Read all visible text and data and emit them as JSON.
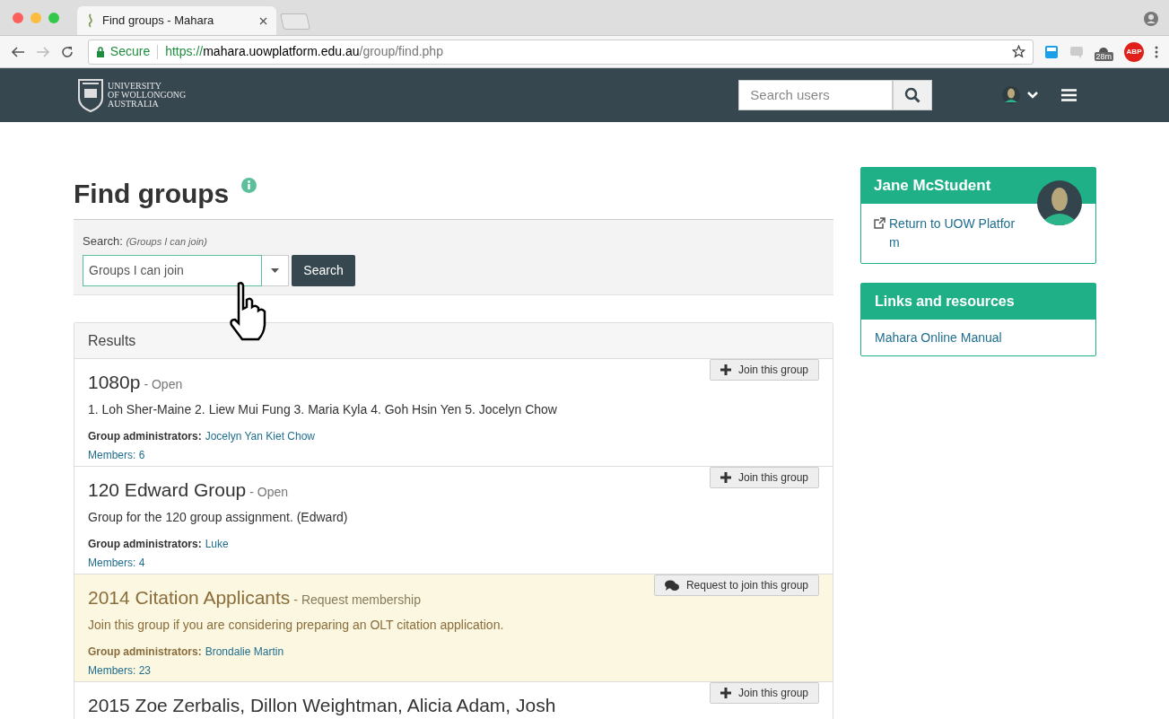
{
  "browser": {
    "tab_title": "Find groups - Mahara",
    "secure_label": "Secure",
    "url_scheme": "https://",
    "url_host": "mahara.uowplatform.edu.au",
    "url_path": "/group/find.php",
    "extension_badge": "28m",
    "abp_label": "ABP"
  },
  "header": {
    "logo_lines": [
      "UNIVERSITY",
      "OF WOLLONGONG",
      "AUSTRALIA"
    ],
    "search": {
      "placeholder": "Search users"
    }
  },
  "page": {
    "title": "Find groups",
    "search_label": "Search:",
    "search_hint": "(Groups I can join)",
    "filter_value": "Groups I can join",
    "search_button": "Search"
  },
  "results": {
    "heading": "Results",
    "groups": [
      {
        "name": "1080p",
        "membership": "- Open",
        "description": "1. Loh Sher-Maine 2. Liew Mui Fung 3. Maria Kyla 4. Goh Hsin Yen 5. Jocelyn Chow",
        "admins_label": "Group administrators:",
        "admins": "Jocelyn Yan Kiet Chow",
        "members": "Members: 6",
        "kind": "join",
        "button": "Join this group"
      },
      {
        "name": "120 Edward Group",
        "membership": "- Open",
        "description": "Group for the 120 group assignment. (Edward)",
        "admins_label": "Group administrators:",
        "admins": "Luke",
        "members": "Members: 4",
        "kind": "join",
        "button": "Join this group"
      },
      {
        "name": "2014 Citation Applicants",
        "membership": "- Request membership",
        "description": "Join this group if you are considering preparing an OLT citation application.",
        "admins_label": "Group administrators:",
        "admins": "Brondalie Martin",
        "members": "Members: 23",
        "kind": "request",
        "button": "Request to join this group"
      },
      {
        "name": "2015 Zoe Zerbalis, Dillon Weightman, Alicia Adam, Josh",
        "kind": "join",
        "button": "Join this group"
      }
    ]
  },
  "sidebar": {
    "profile": {
      "name": "Jane McStudent",
      "link": "Return to UOW Platfor m"
    },
    "links": {
      "title": "Links and resources",
      "items": [
        "Mahara Online Manual"
      ]
    }
  }
}
